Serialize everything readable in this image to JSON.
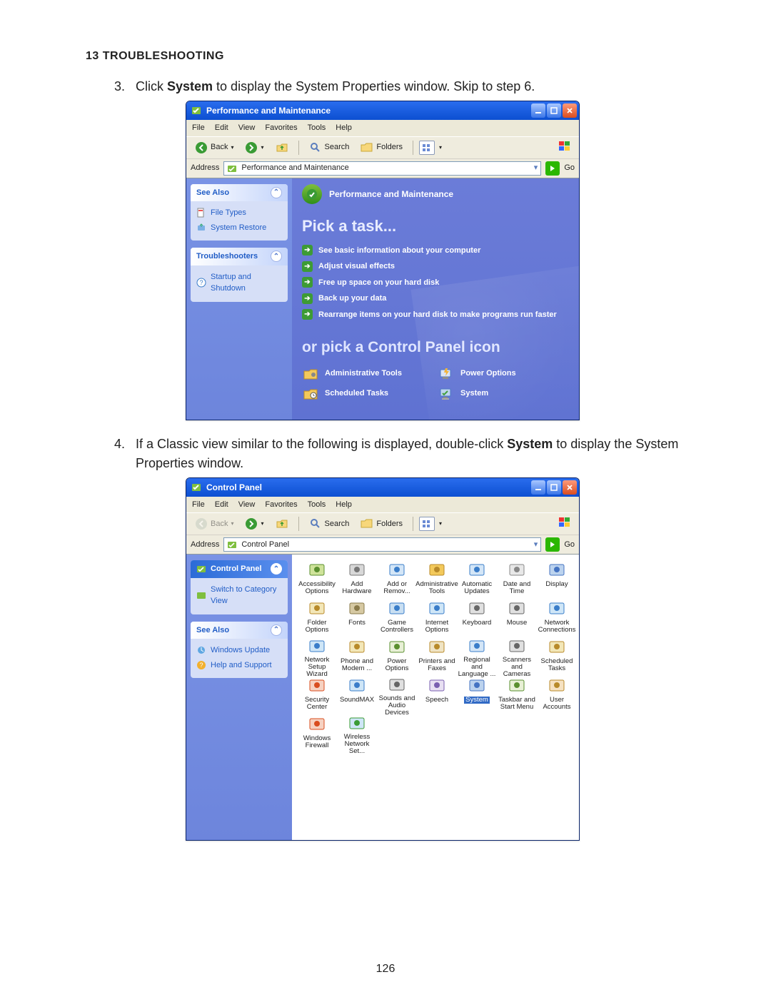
{
  "section_title": "13 TROUBLESHOOTING",
  "steps": {
    "s3": {
      "num": "3.",
      "pre": "Click ",
      "bold": "System",
      "post": " to display the System Properties window. Skip to step 6."
    },
    "s4": {
      "num": "4.",
      "pre": "If a Classic view similar to the following is displayed, double-click ",
      "bold": "System",
      "post": " to display the System Properties window."
    }
  },
  "page_number": "126",
  "win1": {
    "title": "Performance and Maintenance",
    "menu": [
      "File",
      "Edit",
      "View",
      "Favorites",
      "Tools",
      "Help"
    ],
    "toolbar": {
      "back": "Back",
      "search": "Search",
      "folders": "Folders"
    },
    "address_label": "Address",
    "address_value": "Performance and Maintenance",
    "go": "Go",
    "sidebar": {
      "see_also": {
        "head": "See Also",
        "items": [
          "File Types",
          "System Restore"
        ]
      },
      "troubleshooters": {
        "head": "Troubleshooters",
        "items": [
          "Startup and Shutdown"
        ]
      }
    },
    "category_title": "Performance and Maintenance",
    "pick_a_task": "Pick a task...",
    "tasks": [
      "See basic information about your computer",
      "Adjust visual effects",
      "Free up space on your hard disk",
      "Back up your data",
      "Rearrange items on your hard disk to make programs run faster"
    ],
    "or_pick": "or pick a Control Panel icon",
    "cp_icons": [
      "Administrative Tools",
      "Power Options",
      "Scheduled Tasks",
      "System"
    ]
  },
  "win2": {
    "title": "Control Panel",
    "menu": [
      "File",
      "Edit",
      "View",
      "Favorites",
      "Tools",
      "Help"
    ],
    "toolbar": {
      "back": "Back",
      "search": "Search",
      "folders": "Folders"
    },
    "address_label": "Address",
    "address_value": "Control Panel",
    "go": "Go",
    "sidebar": {
      "cp_head": "Control Panel",
      "switch_link": "Switch to Category View",
      "see_also": {
        "head": "See Also",
        "items": [
          "Windows Update",
          "Help and Support"
        ]
      }
    },
    "icons": [
      "Accessibility Options",
      "Add Hardware",
      "Add or Remov...",
      "Administrative Tools",
      "Automatic Updates",
      "Date and Time",
      "Display",
      "Folder Options",
      "Fonts",
      "Game Controllers",
      "Internet Options",
      "Keyboard",
      "Mouse",
      "Network Connections",
      "Network Setup Wizard",
      "Phone and Modem ...",
      "Power Options",
      "Printers and Faxes",
      "Regional and Language ...",
      "Scanners and Cameras",
      "Scheduled Tasks",
      "Security Center",
      "SoundMAX",
      "Sounds and Audio Devices",
      "Speech",
      "System",
      "Taskbar and Start Menu",
      "User Accounts",
      "Windows Firewall",
      "Wireless Network Set..."
    ],
    "selected": "System"
  }
}
